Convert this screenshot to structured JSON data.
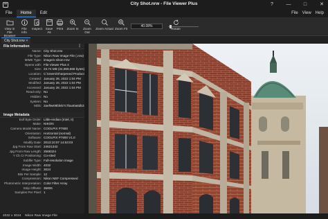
{
  "window": {
    "title": "City Shot.nrw - File Viewer Plus",
    "controls": [
      "?",
      "—",
      "□",
      "✕"
    ]
  },
  "menu": {
    "items": [
      "File",
      "Home",
      "Edit"
    ],
    "active": "Home",
    "right": [
      "File",
      "View",
      "Help"
    ]
  },
  "ribbon": {
    "buttons": [
      {
        "label": "View in File\nBrowser",
        "icon": "folder-icon"
      },
      {
        "label": "File Info",
        "icon": "info-icon"
      },
      {
        "label": "Inspect",
        "icon": "inspect-icon"
      },
      {
        "label": "Save As",
        "icon": "save-icon"
      },
      {
        "label": "Print",
        "icon": "print-icon"
      },
      {
        "label": "Zoom In",
        "icon": "zoom-in-icon"
      },
      {
        "label": "Zoom Out",
        "icon": "zoom-out-icon"
      },
      {
        "label": "Zoom Actual",
        "icon": "zoom-actual-icon"
      },
      {
        "label": "Zoom Fit",
        "icon": "zoom-fit-icon"
      },
      {
        "label": "Rotate",
        "icon": "rotate-icon"
      }
    ],
    "zoom_value": "40.08%",
    "zoom_slider": 0.05
  },
  "tab": {
    "label": "City Shot.nrw"
  },
  "file_info": {
    "heading": "File Information",
    "rows": [
      {
        "k": "Name:",
        "v": "City Shot.nrw"
      },
      {
        "k": "File Type:",
        "v": "Nikon Raw Image File (.nrw)"
      },
      {
        "k": "MIME Type:",
        "v": "image/x-nikon-nrw"
      },
      {
        "k": "Opens with:",
        "v": "File Viewer Plus 4"
      },
      {
        "k": "Size:",
        "v": "23.74 MB (24,969,666 bytes)"
      },
      {
        "k": "Location:",
        "v": "C:\\Users\\Sharpened Productions\\Desktop\\"
      },
      {
        "k": "Created:",
        "v": "January 28, 2022 1:04 PM"
      },
      {
        "k": "Modified:",
        "v": "January 28, 2022 1:04 PM"
      },
      {
        "k": "Accessed:",
        "v": "January 28, 2022 1:04 PM"
      },
      {
        "k": "Read-only:",
        "v": "No"
      },
      {
        "k": "Hidden:",
        "v": "No"
      },
      {
        "k": "System:",
        "v": "No"
      },
      {
        "k": "MD5:",
        "v": "2aef9e09bfeb7c7ba40a8db31bb4fb21"
      }
    ]
  },
  "image_meta": {
    "heading": "Image Metadata",
    "rows": [
      {
        "k": "Exif Byte Order:",
        "v": "Little-endian (Intel, II)"
      },
      {
        "k": "Make:",
        "v": "NIKON"
      },
      {
        "k": "Camera Model Name:",
        "v": "COOLPIX P7800"
      },
      {
        "k": "Orientation:",
        "v": "Horizontal (normal)"
      },
      {
        "k": "Software:",
        "v": "COOLPIX P7800 V1.0"
      },
      {
        "k": "Modify Date:",
        "v": "2013:10:07 14:53:03"
      },
      {
        "k": "Jpg From Raw Start:",
        "v": "24621342"
      },
      {
        "k": "Jpg From Raw Length:",
        "v": "2568324"
      },
      {
        "k": "Y Cb Cr Positioning:",
        "v": "Co-sited"
      },
      {
        "k": "Subfile Type:",
        "v": "Full-resolution image"
      },
      {
        "k": "Image Width:",
        "v": "4032"
      },
      {
        "k": "Image Height:",
        "v": "3024"
      },
      {
        "k": "Bits Per Sample:",
        "v": "12"
      },
      {
        "k": "Compression:",
        "v": "Nikon NEF Compressed"
      },
      {
        "k": "Photometric Interpretation:",
        "v": "Color Filter Array"
      },
      {
        "k": "Strip Offsets:",
        "v": "35806"
      },
      {
        "k": "Samples Per Pixel:",
        "v": "1"
      }
    ]
  },
  "status": {
    "dimensions": "4032 x 3024",
    "file_type": "Nikon Raw Image File"
  }
}
